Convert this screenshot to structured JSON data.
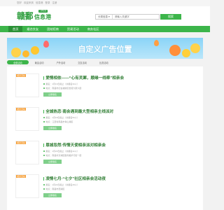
{
  "topbar": {
    "links": [
      "您好",
      "欢迎来到",
      "信息港",
      "登录",
      "注册"
    ]
  },
  "header": {
    "logo_main": "赣鄱",
    "logo_sub": "信息港",
    "logo_tag": "江西信息",
    "search_category": "分类信息",
    "search_placeholder": "请输入关键字",
    "search_button": "搜索"
  },
  "nav": {
    "items": [
      "首页",
      "婚恋交友",
      "团结招商",
      "贸易活动",
      "商务社区"
    ]
  },
  "banner": {
    "title": "自定义广告位置"
  },
  "filter": {
    "items": [
      "全部活动",
      "聚会活动",
      "户外活动",
      "交友活动",
      "比赛活动"
    ]
  },
  "list": [
    {
      "tag": "相亲活动",
      "title": "爱情相依——“心有灵犀，顺缘一线牵”相亲会",
      "line1": "报名：1月16日截止（共报名30人）",
      "line2": "地点：南昌市红谷滩新区世贸大厦六层",
      "button": "立即报名"
    },
    {
      "tag": "相亲活动",
      "title": "全城热恋·南会遇到最大型相亲主线派对",
      "line1": "报名：1月18日截止（共报名56人）",
      "line2": "地点：江西省南昌市青山湖区",
      "button": "立即报名"
    },
    {
      "tag": "相亲活动",
      "title": "恩城忽然·传情天使相亲派对相亲会",
      "line1": "报名：1月20日截止（共报名42人）",
      "line2": "地点：南昌市东湖区胜利路步行街一层",
      "button": "立即报名"
    },
    {
      "tag": "相亲活动",
      "title": "凌情七月·“七夕”社区相亲会活动夜",
      "line1": "报名：1月22日截止（共报名28人）",
      "line2": "地点：南昌市西湖区",
      "button": "立即报名"
    }
  ],
  "colors": {
    "accent": "#3cb54a",
    "accent_dark": "#2a9136",
    "tag": "#f7a23c"
  }
}
